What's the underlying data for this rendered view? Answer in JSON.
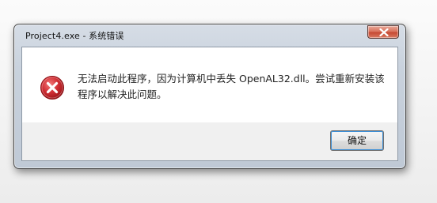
{
  "window": {
    "title": "Project4.exe - 系统错误",
    "close_icon": "close-icon"
  },
  "dialog": {
    "icon": "error-icon",
    "message": "无法启动此程序，因为计算机中丢失 OpenAL32.dll。尝试重新安装该程序以解决此问题。",
    "ok_label": "确定"
  },
  "colors": {
    "error_icon_red": "#c8232b",
    "close_button_red": "#c64a34",
    "focus_ring": "#3d8fd6"
  }
}
